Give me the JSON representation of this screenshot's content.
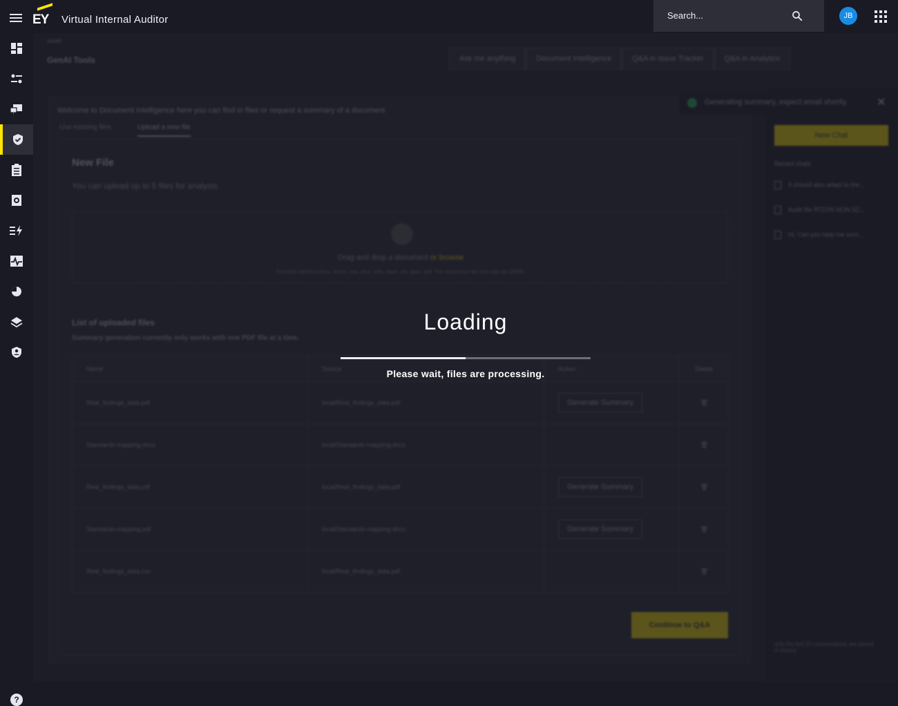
{
  "header": {
    "logo": "EY",
    "app_title": "Virtual Internal Auditor",
    "search_placeholder": "Search...",
    "avatar_initials": "JB"
  },
  "sidebar": {
    "active_index": 3,
    "items": [
      {
        "icon": "dashboard-icon"
      },
      {
        "icon": "toggles-icon"
      },
      {
        "icon": "chat-icon"
      },
      {
        "icon": "shield-check-icon"
      },
      {
        "icon": "clipboard-list-icon"
      },
      {
        "icon": "gear-doc-icon"
      },
      {
        "icon": "flash-list-icon"
      },
      {
        "icon": "pulse-icon"
      },
      {
        "icon": "pie-chart-icon"
      },
      {
        "icon": "layers-icon"
      },
      {
        "icon": "user-shield-icon"
      }
    ]
  },
  "page": {
    "breadcrumb": "HOME",
    "title": "GenAI Tools",
    "tabs": [
      {
        "label": "Ask me anything"
      },
      {
        "label": "Document Intelligence"
      },
      {
        "label": "Q&A in Issue Tracker"
      },
      {
        "label": "Q&A in Analytics"
      }
    ]
  },
  "doc": {
    "welcome": "Welcome to Document Intelligence here you can find in files or request a summary of a document",
    "subtabs": [
      "Use existing files",
      "Upload a new file"
    ],
    "new_file_title": "New File",
    "new_file_sub": "You can upload up to 5 files for analysis.",
    "drop_text": "Drag and drop a document",
    "drop_browse": "or browse",
    "formats": "Formats allowed docx, docm, csv, xlsx, xlsb, xlsm, xls, pptx, pdf. The maximum file size can be 20MB.",
    "list_title": "List of uploaded files",
    "list_sub": "Summary generation currently only works with one PDF file at a time.",
    "columns": [
      "Name",
      "Source",
      "Action",
      "Delete"
    ],
    "rows": [
      {
        "name": "Real_findings_data.pdf",
        "source": "local/Real_findings_data.pdf",
        "action": "Generate Summary"
      },
      {
        "name": "Standards-mapping.docx",
        "source": "local/Standards-mapping.docx",
        "action": ""
      },
      {
        "name": "Real_findings_data.pdf",
        "source": "local/Real_findings_data.pdf",
        "action": "Generate Summary"
      },
      {
        "name": "Standards-mapping.pdf",
        "source": "local/Standards-mapping.docx",
        "action": "Generate Summary"
      },
      {
        "name": "Real_findings_data.csv",
        "source": "local/Real_findings_data.pdf",
        "action": ""
      }
    ],
    "continue_label": "Continue to Q&A"
  },
  "right_panel": {
    "toast": "Generating summary, expect email shortly.",
    "new_chat": "New Chat",
    "recent_title": "Recent chats",
    "recent": [
      "It should also adapt to the...",
      "Audit file RTZXN NON SZ...",
      "Hi, Can you help me sum..."
    ],
    "history_note": "only the last 10 conversations are stored in history"
  },
  "loading": {
    "title": "Loading",
    "message": "Please wait, files are processing.",
    "progress": 0.5
  }
}
